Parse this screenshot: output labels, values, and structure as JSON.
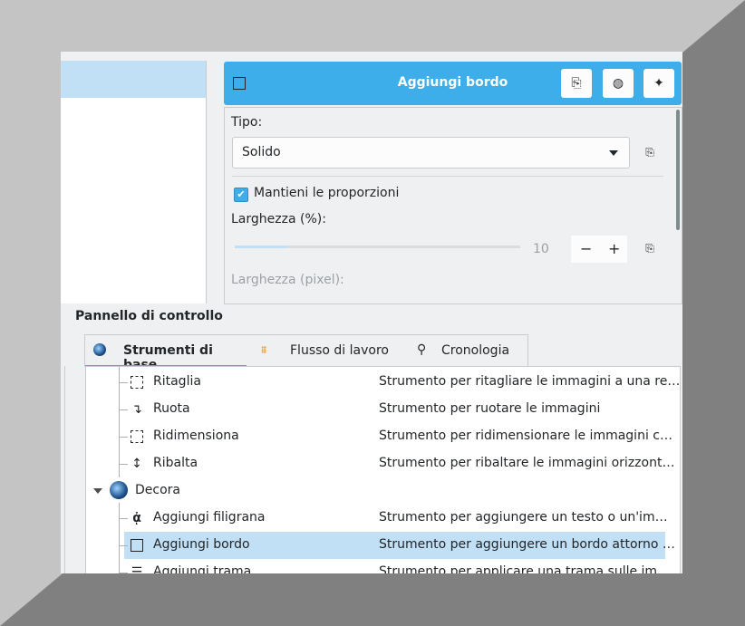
{
  "tool_header": {
    "title": "Aggiungi bordo",
    "icons": [
      "border-tool-icon",
      "document-reset-icon",
      "globe-icon",
      "sparkle-icon"
    ]
  },
  "settings": {
    "type_label": "Tipo:",
    "type_value": "Solido",
    "keep_ratio_label": "Mantieni le proporzioni",
    "keep_ratio_checked": true,
    "width_pct_label": "Larghezza (%):",
    "width_pct_value": "10",
    "width_px_label": "Larghezza (pixel):",
    "stepper_minus": "−",
    "stepper_plus": "+"
  },
  "panel": {
    "title": "Pannello di controllo",
    "tabs": [
      {
        "label": "Strumenti di base",
        "icon": "globe-icon",
        "active": true
      },
      {
        "label": "Flusso di lavoro",
        "icon": "workflow-icon",
        "active": false
      },
      {
        "label": "Cronologia",
        "icon": "search-icon",
        "active": false
      }
    ]
  },
  "tree": {
    "rows": [
      {
        "name": "Ritaglia",
        "desc": "Strumento per ritagliare le immagini a una re…",
        "icon": "crop-icon"
      },
      {
        "name": "Ruota",
        "desc": "Strumento per ruotare le immagini",
        "icon": "rotate-icon"
      },
      {
        "name": "Ridimensiona",
        "desc": "Strumento per ridimensionare le immagini c…",
        "icon": "resize-icon"
      },
      {
        "name": "Ribalta",
        "desc": "Strumento per ribaltare le immagini orizzont…",
        "icon": "flip-icon"
      },
      {
        "name": "Decora",
        "desc": "",
        "icon": "decorate-group-icon",
        "group": true
      },
      {
        "name": "Aggiungi filigrana",
        "desc": "Strumento per aggiungere un testo o un'im…",
        "icon": "watermark-icon"
      },
      {
        "name": "Aggiungi bordo",
        "desc": "Strumento per aggiungere un bordo attorno …",
        "icon": "border-icon",
        "selected": true
      },
      {
        "name": "Aggiungi trama",
        "desc": "Strumento per applicare una trama sulle im…",
        "icon": "texture-icon"
      }
    ]
  },
  "colors": {
    "accent": "#3daee9",
    "selection": "#c2e0f5",
    "window_bg": "#eff0f1"
  }
}
